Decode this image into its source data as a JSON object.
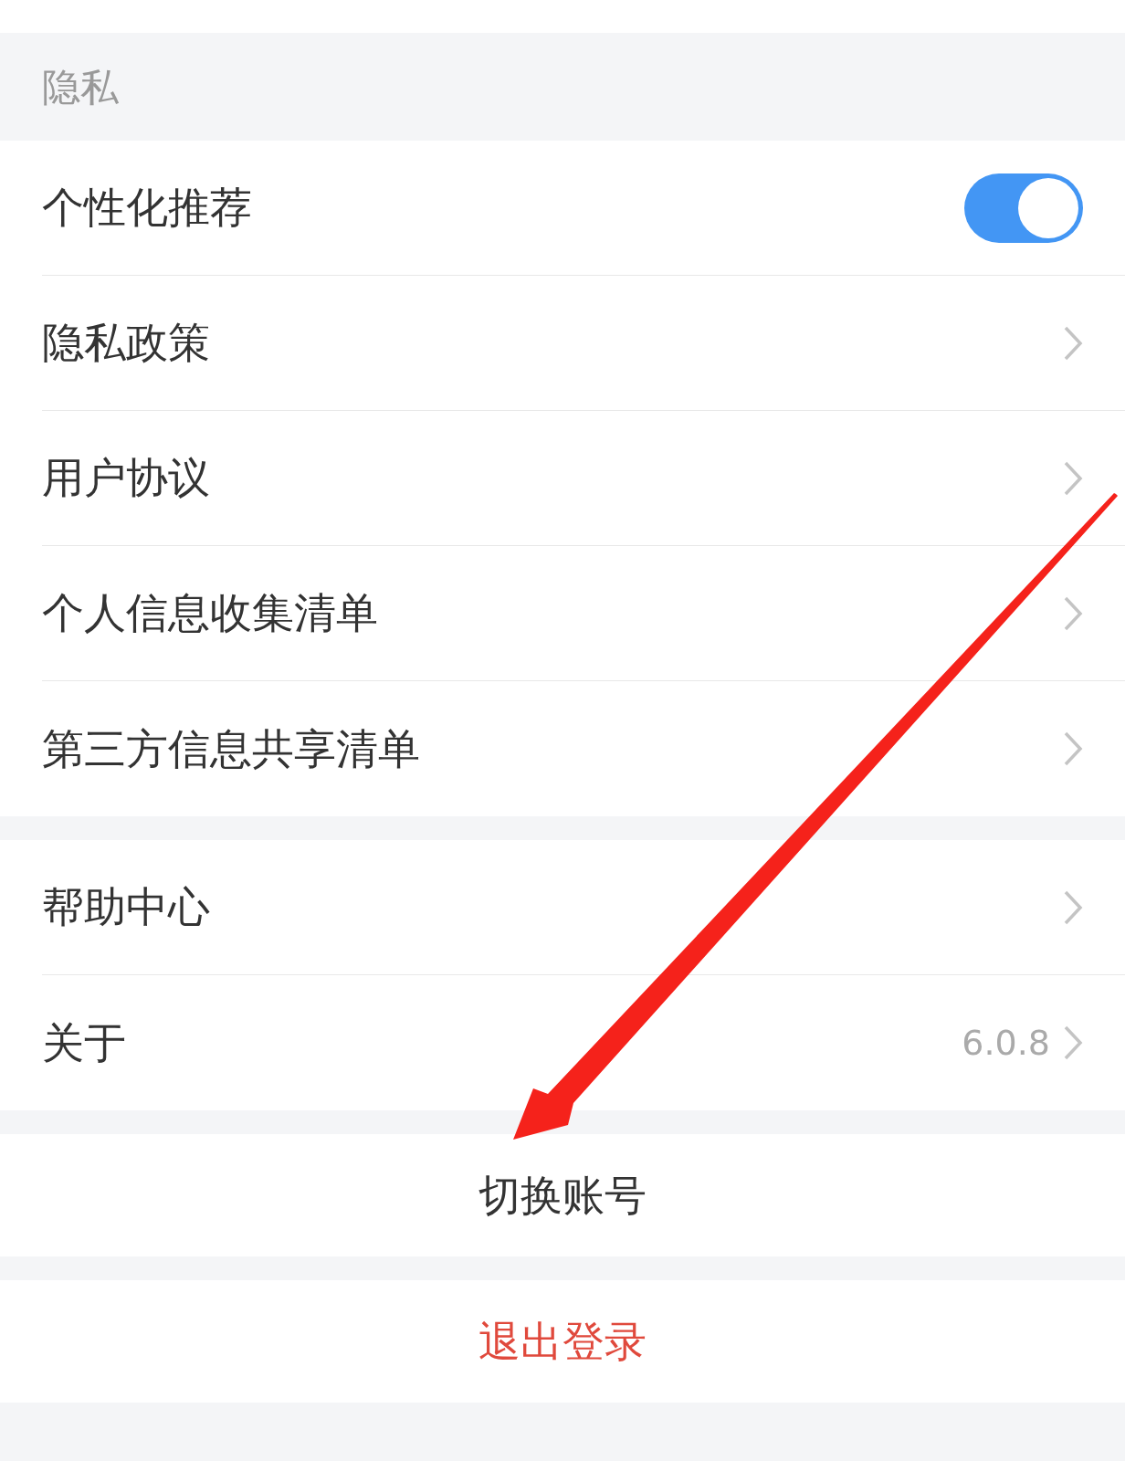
{
  "sections": [
    {
      "header": "隐私",
      "items": [
        {
          "kind": "toggle",
          "label": "个性化推荐",
          "on": true
        },
        {
          "kind": "link",
          "label": "隐私政策"
        },
        {
          "kind": "link",
          "label": "用户协议"
        },
        {
          "kind": "link",
          "label": "个人信息收集清单"
        },
        {
          "kind": "link",
          "label": "第三方信息共享清单"
        }
      ]
    },
    {
      "items": [
        {
          "kind": "link",
          "label": "帮助中心"
        },
        {
          "kind": "link",
          "label": "关于",
          "value": "6.0.8"
        }
      ]
    }
  ],
  "actions": [
    {
      "kind": "normal",
      "label": "切换账号"
    },
    {
      "kind": "danger",
      "label": "退出登录"
    }
  ]
}
